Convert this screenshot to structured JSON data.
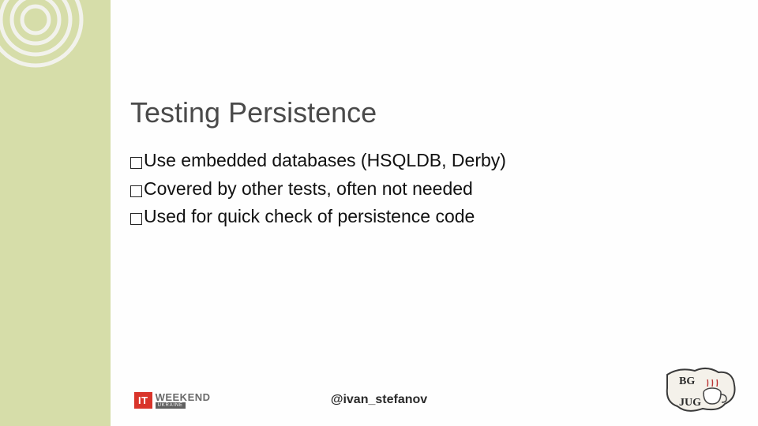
{
  "slide": {
    "title": "Testing Persistence",
    "bullets": [
      "Use embedded databases (HSQLDB, Derby)",
      "Covered by other tests, often not needed",
      "Used for quick check of persistence code"
    ]
  },
  "footer": {
    "handle": "@ivan_stefanov",
    "left_logo": {
      "badge": "IT",
      "text": "WEEKEND",
      "sub": "UKRAINE"
    },
    "right_logo": {
      "label_top": "BG",
      "label_bot": "JUG"
    }
  }
}
